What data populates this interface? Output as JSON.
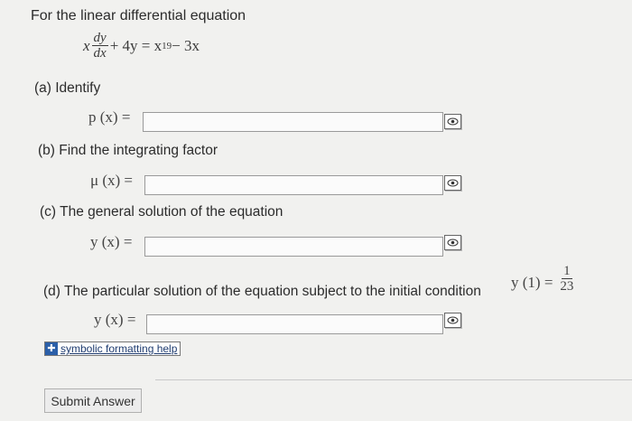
{
  "problem": {
    "intro": "For the linear differential equation",
    "equation": {
      "lhs_prefix": "x",
      "numerator": "dy",
      "denominator": "dx",
      "term2": "+ 4y = x",
      "exponent": "19",
      "tail": " − 3x"
    }
  },
  "parts": [
    {
      "label": "(a) Identify",
      "math_label": "p (x) ="
    },
    {
      "label": "(b) Find the integrating factor",
      "math_label": "μ (x) ="
    },
    {
      "label": "(c) The general solution of the equation",
      "math_label": "y (x) ="
    },
    {
      "label": "(d) The particular solution of the equation subject to the initial condition",
      "math_label": "y (x) ="
    }
  ],
  "initial_condition": {
    "lhs": "y (1) =",
    "numerator": "1",
    "denominator": "23"
  },
  "help_link": "symbolic formatting help",
  "submit_label": "Submit Answer"
}
